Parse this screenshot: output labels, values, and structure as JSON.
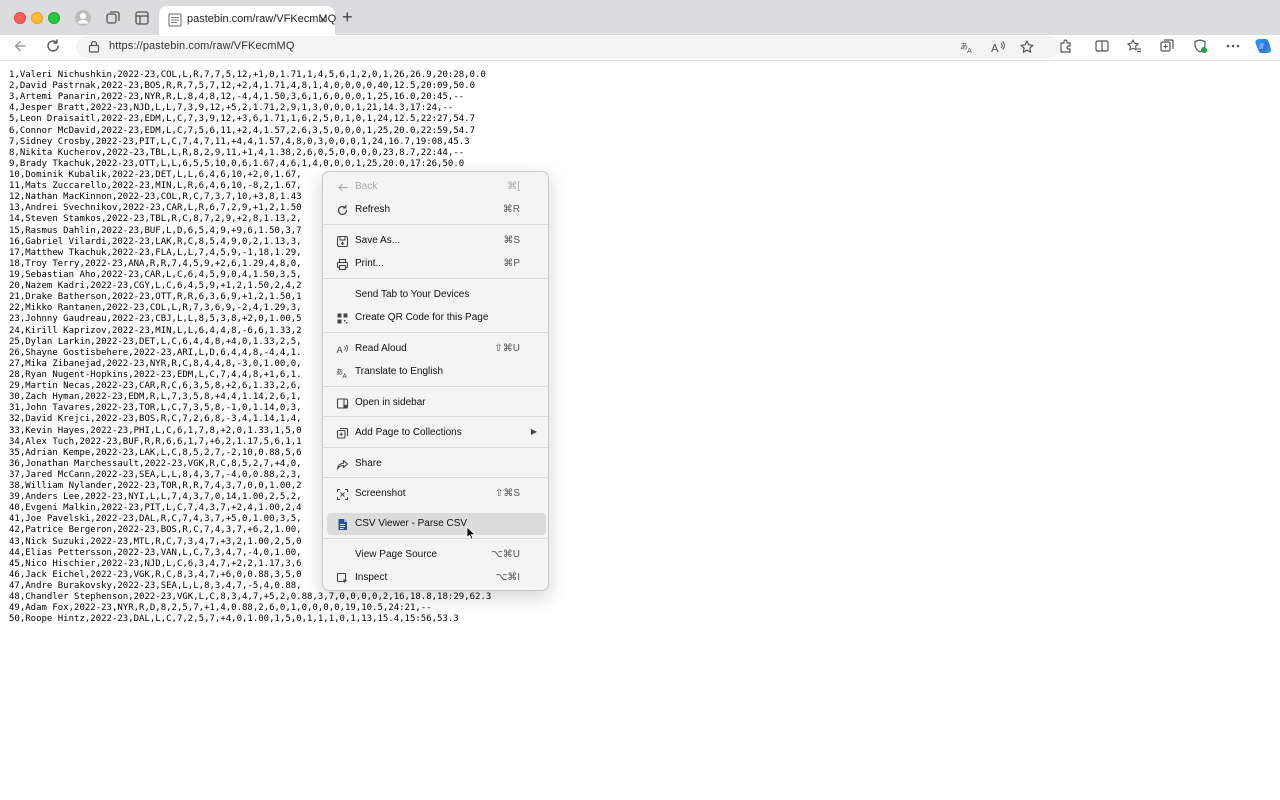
{
  "browser": {
    "tab_title": "pastebin.com/raw/VFKecmMQ",
    "url": "https://pastebin.com/raw/VFKecmMQ",
    "new_tab_glyph": "+",
    "close_glyph": "×",
    "icons": [
      "profile-icon",
      "workspaces-icon",
      "tab-actions-icon",
      "back-icon",
      "refresh-icon",
      "lock-icon",
      "translate-icon",
      "read-aloud-icon",
      "favorite-icon",
      "extensions-icon",
      "split-screen-icon",
      "favorites-icon",
      "collections-icon",
      "browser-essentials-icon",
      "more-icon",
      "copilot-icon"
    ]
  },
  "lines": [
    "1,Valeri Nichushkin,2022-23,COL,L,R,7,7,5,12,+1,0,1.71,1,4,5,6,1,2,0,1,26,26.9,20:28,0.0",
    "2,David Pastrnak,2022-23,BOS,R,R,7,5,7,12,+2,4,1.71,4,8,1,4,0,0,0,0,40,12.5,20:09,50.0",
    "3,Artemi Panarin,2022-23,NYR,R,L,8,4,8,12,-4,4,1.50,3,6,1,6,0,0,0,1,25,16.0,20:45,--",
    "4,Jesper Bratt,2022-23,NJD,L,L,7,3,9,12,+5,2,1.71,2,9,1,3,0,0,0,1,21,14.3,17:24,--",
    "5,Leon Draisaitl,2022-23,EDM,L,C,7,3,9,12,+3,6,1.71,1,6,2,5,0,1,0,1,24,12.5,22:27,54.7",
    "6,Connor McDavid,2022-23,EDM,L,C,7,5,6,11,+2,4,1.57,2,6,3,5,0,0,0,1,25,20.0,22:59,54.7",
    "7,Sidney Crosby,2022-23,PIT,L,C,7,4,7,11,+4,4,1.57,4,8,0,3,0,0,0,1,24,16.7,19:08,45.3",
    "8,Nikita Kucherov,2022-23,TBL,L,R,8,2,9,11,+1,4,1.38,2,6,0,5,0,0,0,0,23,8.7,22:44,--",
    "9,Brady Tkachuk,2022-23,OTT,L,L,6,5,5,10,0,6,1.67,4,6,1,4,0,0,0,1,25,20.0,17:26,50.0",
    "10,Dominik Kubalik,2022-23,DET,L,L,6,4,6,10,+2,0,1.67,",
    "11,Mats Zuccarello,2022-23,MIN,L,R,6,4,6,10,-8,2,1.67,",
    "12,Nathan MacKinnon,2022-23,COL,R,C,7,3,7,10,+3,8,1.43",
    "13,Andrei Svechnikov,2022-23,CAR,L,R,6,7,2,9,+1,2,1.50",
    "14,Steven Stamkos,2022-23,TBL,R,C,8,7,2,9,+2,8,1.13,2,",
    "15,Rasmus Dahlin,2022-23,BUF,L,D,6,5,4,9,+9,6,1.50,3,7",
    "16,Gabriel Vilardi,2022-23,LAK,R,C,8,5,4,9,0,2,1.13,3,",
    "17,Matthew Tkachuk,2022-23,FLA,L,L,7,4,5,9,-1,18,1.29,",
    "18,Troy Terry,2022-23,ANA,R,R,7,4,5,9,+2,6,1.29,4,8,0,",
    "19,Sebastian Aho,2022-23,CAR,L,C,6,4,5,9,0,4,1.50,3,5,",
    "20,Nazem Kadri,2022-23,CGY,L,C,6,4,5,9,+1,2,1.50,2,4,2",
    "21,Drake Batherson,2022-23,OTT,R,R,6,3,6,9,+1,2,1.50,1",
    "22,Mikko Rantanen,2022-23,COL,L,R,7,3,6,9,-2,4,1.29,3,",
    "23,Johnny Gaudreau,2022-23,CBJ,L,L,8,5,3,8,+2,0,1.00,5",
    "24,Kirill Kaprizov,2022-23,MIN,L,L,6,4,4,8,-6,6,1.33,2",
    "25,Dylan Larkin,2022-23,DET,L,C,6,4,4,8,+4,0,1.33,2,5,",
    "26,Shayne Gostisbehere,2022-23,ARI,L,D,6,4,4,8,-4,4,1.",
    "27,Mika Zibanejad,2022-23,NYR,R,C,8,4,4,8,-3,0,1.00,0,",
    "28,Ryan Nugent-Hopkins,2022-23,EDM,L,C,7,4,4,8,+1,6,1.",
    "29,Martin Necas,2022-23,CAR,R,C,6,3,5,8,+2,6,1.33,2,6,",
    "30,Zach Hyman,2022-23,EDM,R,L,7,3,5,8,+4,4,1.14,2,6,1,",
    "31,John Tavares,2022-23,TOR,L,C,7,3,5,8,-1,0,1.14,0,3,",
    "32,David Krejci,2022-23,BOS,R,C,7,2,6,8,-3,4,1.14,1,4,",
    "33,Kevin Hayes,2022-23,PHI,L,C,6,1,7,8,+2,0,1.33,1,5,0",
    "34,Alex Tuch,2022-23,BUF,R,R,6,6,1,7,+6,2,1.17,5,6,1,1",
    "35,Adrian Kempe,2022-23,LAK,L,C,8,5,2,7,-2,10,0.88,5,6",
    "36,Jonathan Marchessault,2022-23,VGK,R,C,8,5,2,7,+4,0,",
    "37,Jared McCann,2022-23,SEA,L,L,8,4,3,7,-4,0,0.88,2,3,",
    "38,William Nylander,2022-23,TOR,R,R,7,4,3,7,0,0,1.00,2",
    "39,Anders Lee,2022-23,NYI,L,L,7,4,3,7,0,14,1.00,2,5,2,",
    "40,Evgeni Malkin,2022-23,PIT,L,C,7,4,3,7,+2,4,1.00,2,4",
    "41,Joe Pavelski,2022-23,DAL,R,C,7,4,3,7,+5,0,1.00,3,5,",
    "42,Patrice Bergeron,2022-23,BOS,R,C,7,4,3,7,+6,2,1.00,",
    "43,Nick Suzuki,2022-23,MTL,R,C,7,3,4,7,+3,2,1.00,2,5,0",
    "44,Elias Pettersson,2022-23,VAN,L,C,7,3,4,7,-4,0,1.00,",
    "45,Nico Hischier,2022-23,NJD,L,C,6,3,4,7,+2,2,1.17,3,6",
    "46,Jack Eichel,2022-23,VGK,R,C,8,3,4,7,+6,0,0.88,3,5,0",
    "47,Andre Burakovsky,2022-23,SEA,L,L,8,3,4,7,-5,4,0.88,",
    "48,Chandler Stephenson,2022-23,VGK,L,C,8,3,4,7,+5,2,0.88,3,7,0,0,0,0,2,16,18.8,18:29,62.3",
    "49,Adam Fox,2022-23,NYR,R,D,8,2,5,7,+1,4,0.88,2,6,0,1,0,0,0,0,19,10.5,24:21,--",
    "50,Roope Hintz,2022-23,DAL,L,C,7,2,5,7,+4,0,1.00,1,5,0,1,1,1,0,1,13,15.4,15:56,53.3"
  ],
  "context_menu": {
    "items": [
      {
        "id": "back",
        "label": "Back",
        "shortcut": "⌘[",
        "icon": "back-arrow-icon",
        "disabled": true
      },
      {
        "id": "refresh",
        "label": "Refresh",
        "shortcut": "⌘R",
        "icon": "refresh-icon"
      },
      {
        "id": "save-as",
        "label": "Save As...",
        "shortcut": "⌘S",
        "icon": "save-icon"
      },
      {
        "id": "print",
        "label": "Print...",
        "shortcut": "⌘P",
        "icon": "printer-icon"
      },
      {
        "id": "send-tab",
        "label": "Send Tab to Your Devices",
        "shortcut": "",
        "icon": ""
      },
      {
        "id": "qr-code",
        "label": "Create QR Code for this Page",
        "shortcut": "",
        "icon": "qr-code-icon"
      },
      {
        "id": "read-aloud",
        "label": "Read Aloud",
        "shortcut": "⇧⌘U",
        "icon": "read-aloud-icon"
      },
      {
        "id": "translate",
        "label": "Translate to English",
        "shortcut": "",
        "icon": "translate-icon"
      },
      {
        "id": "open-sidebar",
        "label": "Open in sidebar",
        "shortcut": "",
        "icon": "sidebar-icon"
      },
      {
        "id": "add-collections",
        "label": "Add Page to Collections",
        "shortcut": "",
        "icon": "collections-icon",
        "submenu": true
      },
      {
        "id": "share",
        "label": "Share",
        "shortcut": "",
        "icon": "share-icon"
      },
      {
        "id": "screenshot",
        "label": "Screenshot",
        "shortcut": "⇧⌘S",
        "icon": "screenshot-icon"
      },
      {
        "id": "csv-viewer",
        "label": "CSV Viewer - Parse CSV",
        "shortcut": "",
        "icon": "csv-document-icon",
        "highlighted": true
      },
      {
        "id": "view-source",
        "label": "View Page Source",
        "shortcut": "⌥⌘U",
        "icon": ""
      },
      {
        "id": "inspect",
        "label": "Inspect",
        "shortcut": "⌥⌘I",
        "icon": "inspect-icon"
      }
    ],
    "submenu_glyph": "▶"
  },
  "colors": {
    "accent": "#1f3c88",
    "tab_bar": "#dcdcde",
    "menu_bg": "#f4f4f4",
    "menu_highlight": "#dcdcdc"
  }
}
